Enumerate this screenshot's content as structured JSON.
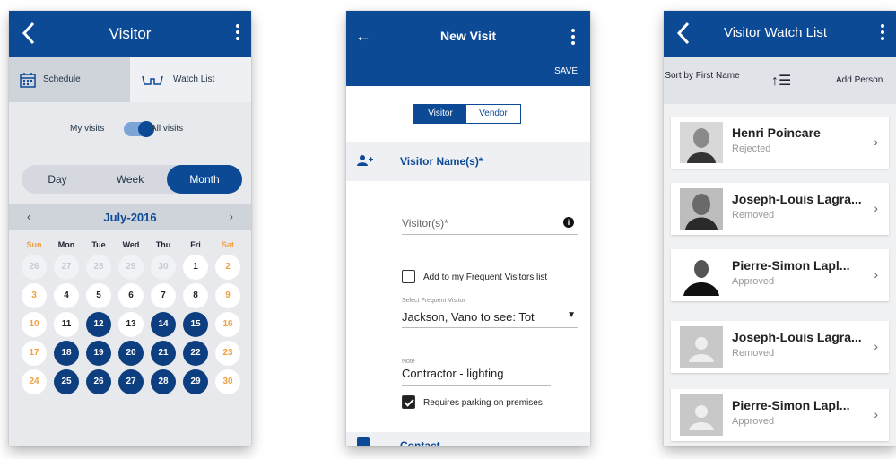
{
  "screens": {
    "calendar": {
      "title": "Visitor",
      "tabs": [
        {
          "label": "Schedule"
        },
        {
          "label": "Watch List"
        }
      ],
      "toggle": {
        "left": "My visits",
        "right": "All visits"
      },
      "views": [
        "Day",
        "Week",
        "Month"
      ],
      "month": "July-2016",
      "weekdays": [
        "Sun",
        "Mon",
        "Tue",
        "Wed",
        "Thu",
        "Fri",
        "Sat"
      ],
      "weeks": [
        [
          "26",
          "27",
          "28",
          "29",
          "30",
          "1",
          "2"
        ],
        [
          "3",
          "4",
          "5",
          "6",
          "7",
          "8",
          "9"
        ],
        [
          "10",
          "11",
          "12",
          "13",
          "14",
          "15",
          "16"
        ],
        [
          "17",
          "18",
          "19",
          "20",
          "21",
          "22",
          "23"
        ],
        [
          "24",
          "25",
          "26",
          "27",
          "28",
          "29",
          "30"
        ]
      ],
      "selected_days": [
        "12",
        "14",
        "15",
        "18",
        "19",
        "20",
        "21",
        "22",
        "25",
        "26",
        "27",
        "28",
        "29"
      ]
    },
    "new_visit": {
      "title": "New Visit",
      "save": "SAVE",
      "segments": [
        "Visitor",
        "Vendor"
      ],
      "section_title": "Visitor Name(s)*",
      "visitor_placeholder": "Visitor(s)*",
      "add_frequent_label": "Add to my Frequent Visitors list",
      "select_label": "Select Frequent Visitor",
      "select_value": "Jackson, Vano to see: Tot",
      "note_label": "Note",
      "note_value": "Contractor - lighting",
      "parking_label": "Requires parking on premises",
      "contact_title": "Contact"
    },
    "watch_list": {
      "title": "Visitor Watch List",
      "sort_label": "Sort by First Name",
      "sort_icon": "sort-ascending-icon",
      "add_label": "Add Person",
      "people": [
        {
          "name": "Henri Poincare",
          "status": "Rejected"
        },
        {
          "name": "Joseph-Louis Lagra...",
          "status": "Removed"
        },
        {
          "name": "Pierre-Simon Lapl...",
          "status": "Approved"
        },
        {
          "name": "Joseph-Louis Lagra...",
          "status": "Removed"
        },
        {
          "name": "Pierre-Simon Lapl...",
          "status": "Approved"
        }
      ]
    }
  },
  "colors": {
    "brand": "#0d4a95",
    "weekend": "#f0a040",
    "muted": "#999999"
  }
}
